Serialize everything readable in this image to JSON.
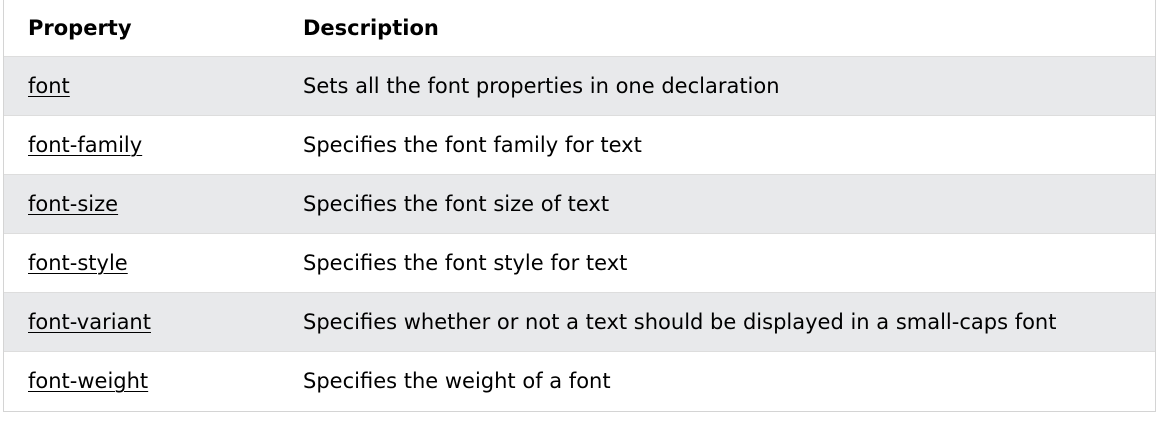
{
  "table": {
    "headers": {
      "property": "Property",
      "description": "Description"
    },
    "rows": [
      {
        "property": "font",
        "description": "Sets all the font properties in one declaration"
      },
      {
        "property": "font-family",
        "description": "Specifies the font family for text"
      },
      {
        "property": "font-size",
        "description": "Specifies the font size of text"
      },
      {
        "property": "font-style",
        "description": "Specifies the font style for text"
      },
      {
        "property": "font-variant",
        "description": "Specifies whether or not a text should be displayed in a small-caps font"
      },
      {
        "property": "font-weight",
        "description": "Specifies the weight of a font"
      }
    ]
  },
  "colors": {
    "shaded_row": "#e8e9eb",
    "row_border": "#dddddd",
    "text": "#000000"
  }
}
